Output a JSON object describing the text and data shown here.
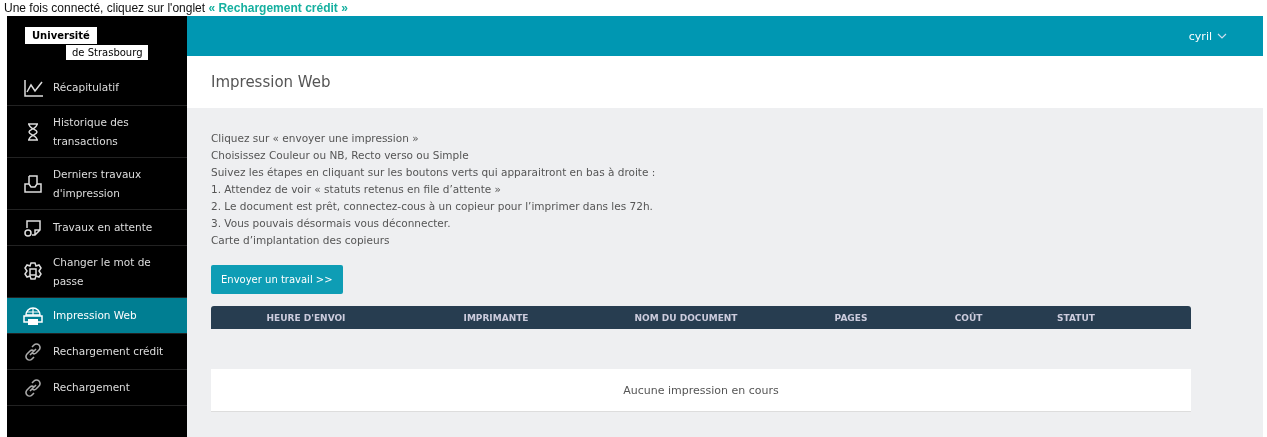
{
  "caption": {
    "lead": "Une fois connecté, cliquez sur l'onglet",
    "link": "« Rechargement crédit »"
  },
  "logo": {
    "line1": "Université",
    "line2": "de Strasbourg"
  },
  "user": {
    "name": "cyril"
  },
  "sidebar": {
    "items": [
      {
        "label": "Récapitulatif",
        "selected": false
      },
      {
        "label": "Historique des transactions",
        "selected": false
      },
      {
        "label": "Derniers travaux d'impression",
        "selected": false
      },
      {
        "label": "Travaux en attente",
        "selected": false
      },
      {
        "label": "Changer le mot de passe",
        "selected": false
      },
      {
        "label": "Impression Web",
        "selected": true
      },
      {
        "label": "Rechargement crédit",
        "selected": false
      },
      {
        "label": "Rechargement",
        "selected": false
      }
    ]
  },
  "page": {
    "title": "Impression Web"
  },
  "instructions": [
    "Cliquez sur « envoyer une impression »",
    "Choisissez Couleur ou NB, Recto verso ou Simple",
    "Suivez les étapes en cliquant sur les boutons verts qui apparaitront en bas à droite :",
    "1. Attendez de voir « statuts retenus en file d’attente »",
    "2. Le document est prêt, connectez-cous à un copieur pour l’imprimer dans les 72h.",
    "3. Vous pouvais désormais vous déconnecter.",
    "Carte d’implantation des copieurs"
  ],
  "send_button": "Envoyer un travail >>",
  "table": {
    "columns": [
      "HEURE D'ENVOI",
      "IMPRIMANTE",
      "NOM DU DOCUMENT",
      "PAGES",
      "COÛT",
      "STATUT"
    ],
    "empty": "Aucune impression en cours"
  }
}
